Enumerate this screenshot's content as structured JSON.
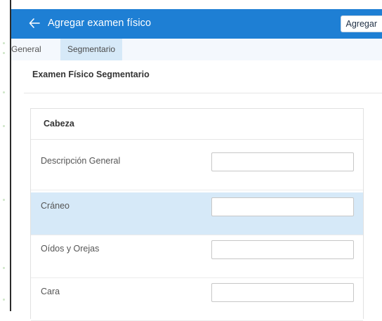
{
  "header": {
    "title": "Agregar examen físico",
    "add_label": "Agregar",
    "color": "#1e7fd4"
  },
  "tabs": [
    {
      "label": "General",
      "active": false
    },
    {
      "label": "Segmentario",
      "active": true
    }
  ],
  "section": {
    "title": "Examen Físico Segmentario"
  },
  "card": {
    "title": "Cabeza",
    "rows": [
      {
        "label": "Descripción General",
        "value": "",
        "selected": false
      },
      {
        "label": "Cráneo",
        "value": "",
        "selected": true
      },
      {
        "label": "Oídos y Orejas",
        "value": "",
        "selected": false
      },
      {
        "label": "Cara",
        "value": "",
        "selected": false
      }
    ]
  }
}
